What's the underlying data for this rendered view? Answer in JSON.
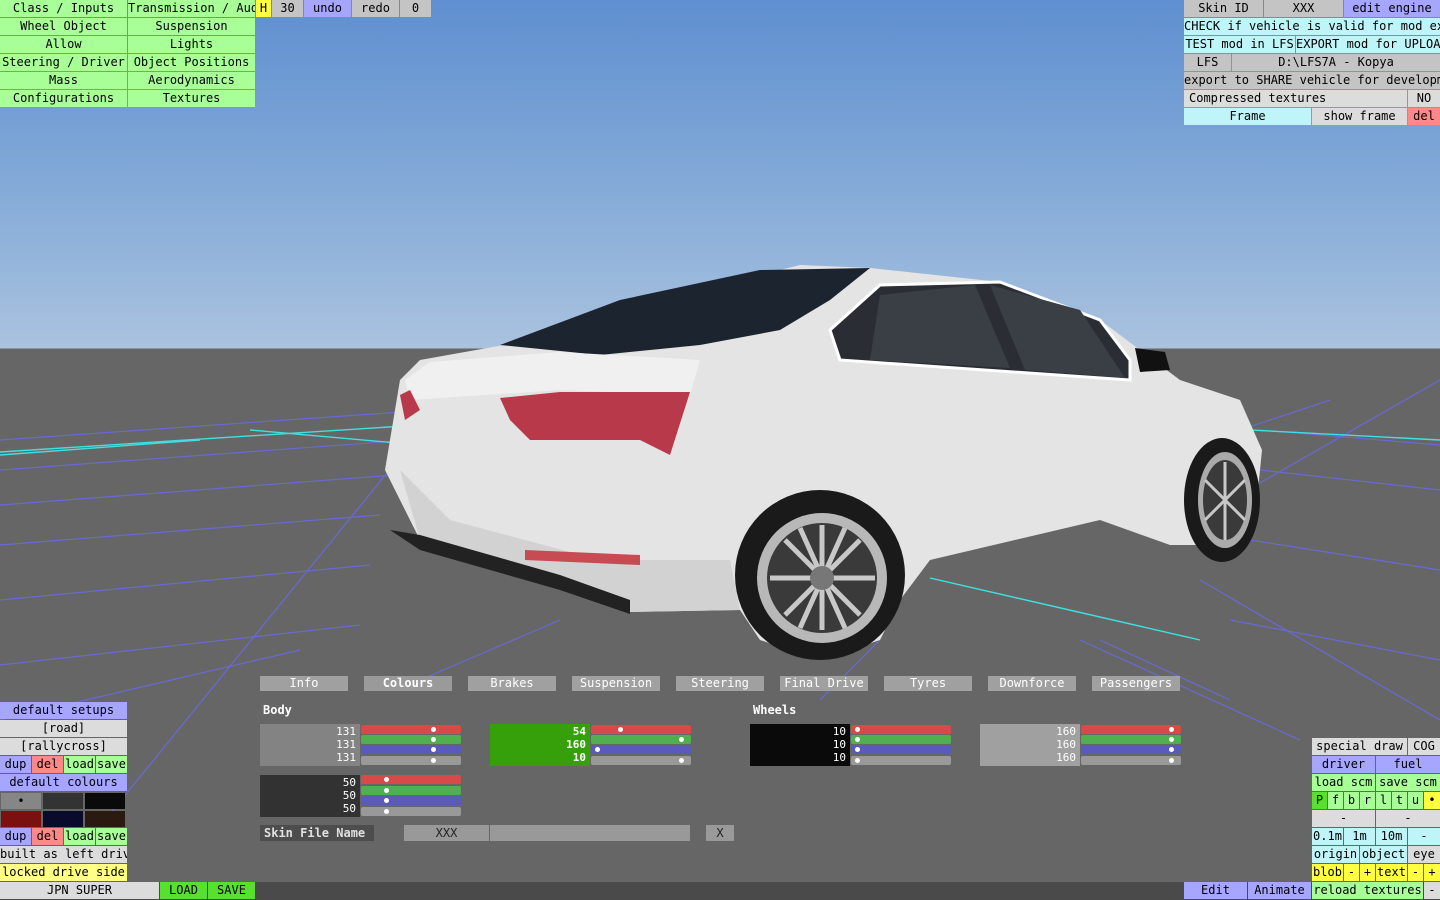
{
  "top_left": {
    "col1": [
      "Class / Inputs",
      "Wheel Object",
      "Allow",
      "Steering / Driver",
      "Mass",
      "Configurations"
    ],
    "col2": [
      "Transmission / Audio",
      "Suspension",
      "Lights",
      "Object Positions",
      "Aerodynamics",
      "Textures"
    ],
    "h_label": "H",
    "h_value": "30",
    "undo": "undo",
    "redo": "redo",
    "redo_count": "0"
  },
  "top_right": {
    "skin_id_label": "Skin ID",
    "skin_id_value": "XXX",
    "edit_engine": "edit engine",
    "check_valid": "CHECK if vehicle is valid for mod export",
    "test_mod": "TEST mod in LFS",
    "export_mod": "EXPORT mod for UPLOAD",
    "lfs_label": "LFS",
    "lfs_path": "D:\\LFS7A - Kopya",
    "export_share": "export to SHARE vehicle for development",
    "compressed_label": "Compressed textures",
    "compressed_value": "NO",
    "frame": "Frame",
    "show_frame": "show frame",
    "del": "del"
  },
  "tabs": [
    "Info",
    "Colours",
    "Brakes",
    "Suspension",
    "Steering",
    "Final Drive",
    "Tyres",
    "Downforce",
    "Passengers"
  ],
  "colours": {
    "body_label": "Body",
    "wheels_label": "Wheels",
    "body1": [
      "131",
      "131",
      "131"
    ],
    "body2": [
      "54",
      "160",
      "10"
    ],
    "body3": [
      "50",
      "50",
      "50"
    ],
    "wheel1": [
      "10",
      "10",
      "10"
    ],
    "wheel2": [
      "160",
      "160",
      "160"
    ],
    "skin_file_label": "Skin File Name",
    "skin_file_value": "XXX",
    "close": "X"
  },
  "left_panel": {
    "default_setups": "default setups",
    "road": "[road]",
    "rallycross": "[rallycross]",
    "dup": "dup",
    "del": "del",
    "load": "load",
    "save": "save",
    "default_colours": "default colours",
    "swatch_mark": "•",
    "built_as": "built as left drive",
    "locked_side": "locked drive side"
  },
  "bottom_bar": {
    "vehicle_name": "JPN SUPER",
    "load": "LOAD",
    "save": "SAVE",
    "edit": "Edit",
    "animate": "Animate",
    "reload_textures": "reload textures",
    "minus": "-"
  },
  "right_panel": {
    "special_draw": "special draw",
    "cog": "COG",
    "driver": "driver",
    "fuel": "fuel",
    "load_scm": "load scm",
    "save_scm": "save scm",
    "letters": [
      "P",
      "f",
      "b",
      "r",
      "l",
      "t",
      "u"
    ],
    "dot": "•",
    "minus": "-",
    "scale": [
      "0.1m",
      "1m",
      "10m",
      "-"
    ],
    "origin": "origin",
    "object": "object",
    "eye": "eye",
    "blob": "blob",
    "plus": "+",
    "text": "text"
  },
  "colors": {
    "green_button": "#a8ff98",
    "light_blue_button": "#bff4f8",
    "purple_button": "#a6a6ff",
    "red_button": "#ff8888",
    "yellow_button": "#ffff40"
  }
}
